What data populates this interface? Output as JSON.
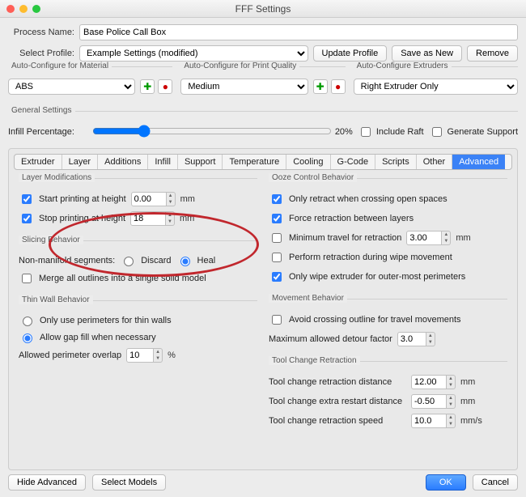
{
  "window": {
    "title": "FFF Settings"
  },
  "header": {
    "processLabel": "Process Name:",
    "processName": "Base Police Call Box",
    "profileLabel": "Select Profile:",
    "profileValue": "Example Settings (modified)",
    "updateProfile": "Update Profile",
    "saveAsNew": "Save as New",
    "remove": "Remove"
  },
  "autoconf": {
    "materialLabel": "Auto-Configure for Material",
    "materialValue": "ABS",
    "qualityLabel": "Auto-Configure for Print Quality",
    "qualityValue": "Medium",
    "extrudersLabel": "Auto-Configure Extruders",
    "extrudersValue": "Right Extruder Only"
  },
  "general": {
    "label": "General Settings",
    "infillLabel": "Infill Percentage:",
    "infillValue": "20%",
    "includeRaft": "Include Raft",
    "genSupport": "Generate Support"
  },
  "tabs": [
    "Extruder",
    "Layer",
    "Additions",
    "Infill",
    "Support",
    "Temperature",
    "Cooling",
    "G-Code",
    "Scripts",
    "Other",
    "Advanced"
  ],
  "adv": {
    "layerMod": {
      "title": "Layer Modifications",
      "startLabel": "Start printing at height",
      "startVal": "0.00",
      "stopLabel": "Stop printing at height",
      "stopVal": "18",
      "mm": "mm"
    },
    "slicing": {
      "title": "Slicing Behavior",
      "nonManifold": "Non-manifold segments:",
      "discard": "Discard",
      "heal": "Heal",
      "merge": "Merge all outlines into a single solid model"
    },
    "thinWall": {
      "title": "Thin Wall Behavior",
      "opt1": "Only use perimeters for thin walls",
      "opt2": "Allow gap fill when necessary",
      "overlapLabel": "Allowed perimeter overlap",
      "overlapVal": "10",
      "pct": "%"
    },
    "ooze": {
      "title": "Ooze Control Behavior",
      "r1": "Only retract when crossing open spaces",
      "r2": "Force retraction between layers",
      "r3": "Minimum travel for retraction",
      "r3v": "3.00",
      "r4": "Perform retraction during wipe movement",
      "r5": "Only wipe extruder for outer-most perimeters"
    },
    "move": {
      "title": "Movement Behavior",
      "r1": "Avoid crossing outline for travel movements",
      "r2": "Maximum allowed detour factor",
      "r2v": "3.0"
    },
    "tool": {
      "title": "Tool Change Retraction",
      "r1": "Tool change retraction distance",
      "r1v": "12.00",
      "u1": "mm",
      "r2": "Tool change extra restart distance",
      "r2v": "-0.50",
      "u2": "mm",
      "r3": "Tool change retraction speed",
      "r3v": "10.0",
      "u3": "mm/s"
    }
  },
  "footer": {
    "hide": "Hide Advanced",
    "select": "Select Models",
    "ok": "OK",
    "cancel": "Cancel"
  }
}
